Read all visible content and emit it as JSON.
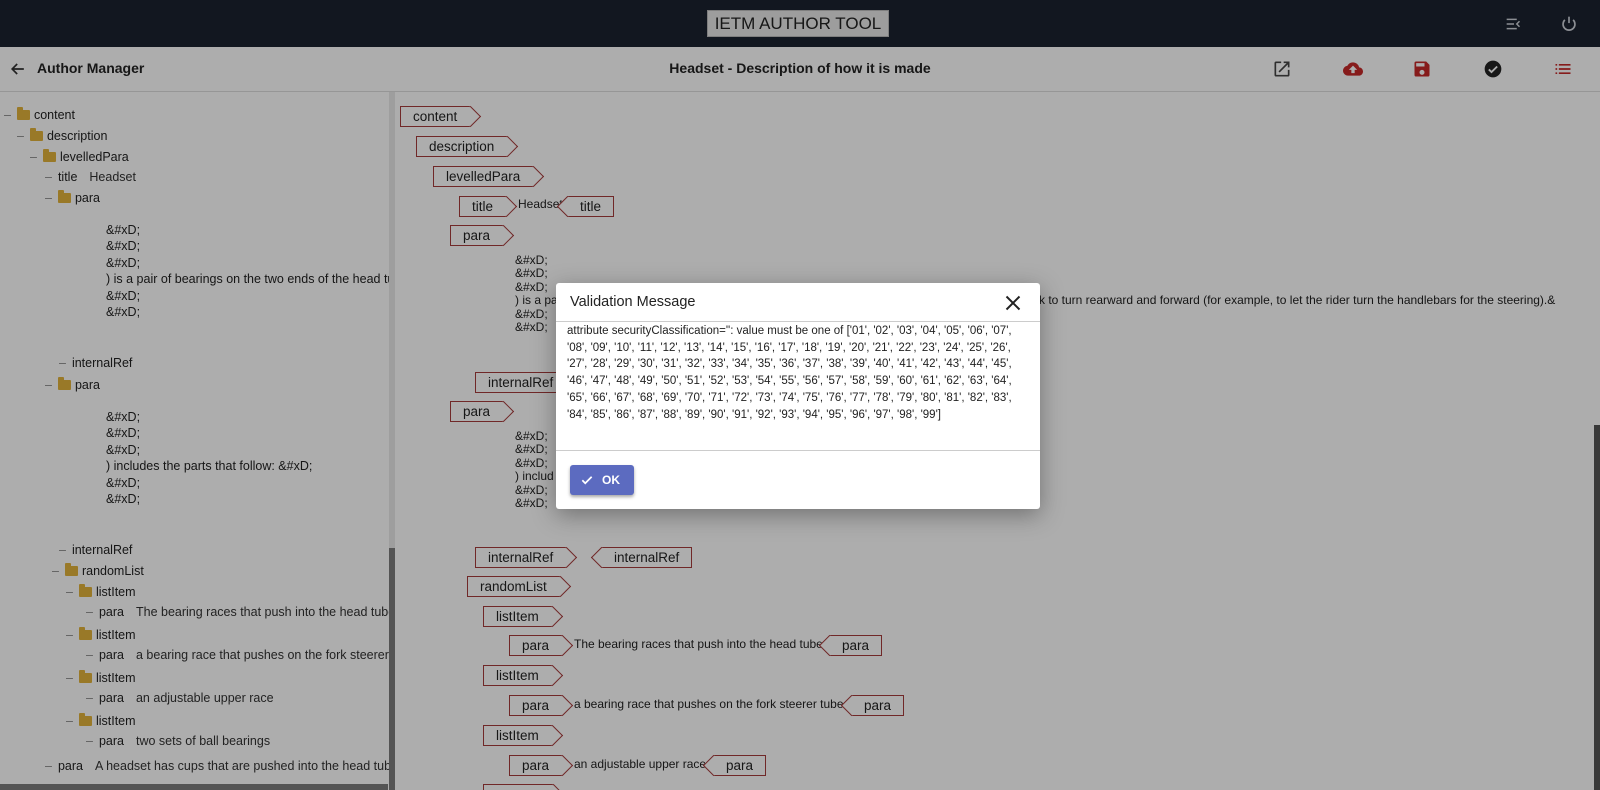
{
  "app": {
    "title": "IETM AUTHOR TOOL"
  },
  "header": {
    "title": "Author Manager",
    "document_title": "Headset - Description of how it is made"
  },
  "tree": {
    "nodes": [
      {
        "label": "content",
        "text": ""
      },
      {
        "label": "description",
        "text": ""
      },
      {
        "label": "levelledPara",
        "text": ""
      },
      {
        "label": "title",
        "text": "Headset"
      },
      {
        "label": "para",
        "text": ""
      },
      {
        "label": "internalRef",
        "text": ""
      },
      {
        "label": "para",
        "text": ""
      },
      {
        "label": "internalRef",
        "text": ""
      },
      {
        "label": "randomList",
        "text": ""
      },
      {
        "label": "listItem",
        "text": ""
      },
      {
        "label": "para",
        "text": "The bearing races that push into the head tube"
      },
      {
        "label": "listItem",
        "text": ""
      },
      {
        "label": "para",
        "text": "a bearing race that pushes on the fork steerer"
      },
      {
        "label": "listItem",
        "text": ""
      },
      {
        "label": "para",
        "text": "an adjustable upper race"
      },
      {
        "label": "listItem",
        "text": ""
      },
      {
        "label": "para",
        "text": "two sets of ball bearings"
      },
      {
        "label": "para",
        "text": "A headset has cups that are pushed into the head tube"
      }
    ],
    "para1_lines": [
      "&#xD;",
      "&#xD;",
      "&#xD;",
      ") is a pair of bearings on the two ends of the head tube",
      "&#xD;",
      "&#xD;"
    ],
    "para2_lines": [
      "&#xD;",
      "&#xD;",
      "&#xD;",
      ") includes the parts that follow: &#xD;",
      "&#xD;",
      "&#xD;"
    ]
  },
  "editor": {
    "tags": {
      "content": "content",
      "description": "description",
      "levelledPara": "levelledPara",
      "title": "title",
      "para": "para",
      "internalRef": "internalRef",
      "randomList": "randomList",
      "listItem": "listItem"
    },
    "title_text": "Headset",
    "para1_lines": [
      "&#xD;",
      "&#xD;",
      "&#xD;",
      ") is a pa",
      "&#xD;",
      "&#xD;"
    ],
    "para1_tail": "rk to turn rearward and forward (for example, to let the rider turn the handlebars for the steering).&",
    "para2_lines": [
      "&#xD;",
      "&#xD;",
      "&#xD;",
      ") includ",
      "&#xD;",
      "&#xD;"
    ],
    "list_items": [
      "The bearing races that push into the head tube",
      "a bearing race that pushes on the fork steerer tube",
      "an adjustable upper race"
    ]
  },
  "modal": {
    "title": "Validation Message",
    "message": "attribute securityClassification='': value must be one of ['01', '02', '03', '04', '05', '06', '07', '08', '09', '10', '11', '12', '13', '14', '15', '16', '17', '18', '19', '20', '21', '22', '23', '24', '25', '26', '27', '28', '29', '30', '31', '32', '33', '34', '35', '36', '37', '38', '39', '40', '41', '42', '43', '44', '45', '46', '47', '48', '49', '50', '51', '52', '53', '54', '55', '56', '57', '58', '59', '60', '61', '62', '63', '64', '65', '66', '67', '68', '69', '70', '71', '72', '73', '74', '75', '76', '77', '78', '79', '80', '81', '82', '83', '84', '85', '86', '87', '88', '89', '90', '91', '92', '93', '94', '95', '96', '97', '98', '99']",
    "ok_label": "OK"
  },
  "colors": {
    "topbar": "#1b2330",
    "tag_border": "#a63b3b",
    "button": "#5c6bc0",
    "save_icon": "#c62828",
    "folder": "#e2b33c"
  },
  "icons": {
    "header_actions": [
      "open-external-icon",
      "cloud-upload-icon",
      "save-icon",
      "validate-check-icon",
      "list-icon"
    ],
    "top_actions": [
      "menu-collapse-icon",
      "power-icon"
    ]
  }
}
